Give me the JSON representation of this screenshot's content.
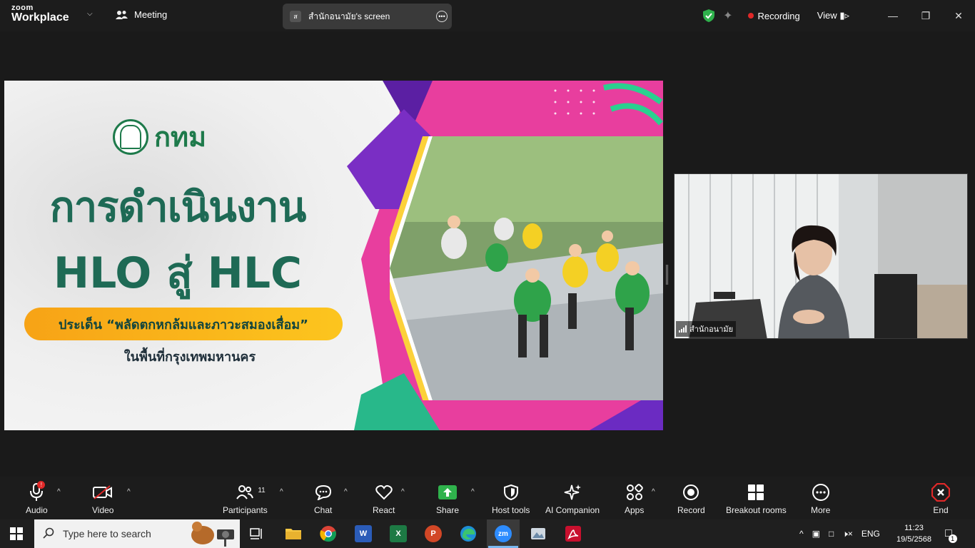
{
  "titlebar": {
    "logo_top": "zoom",
    "logo_bottom": "Workplace",
    "meeting_label": "Meeting",
    "screen_share_avatar": "ส",
    "screen_share_label": "สำนักอนามัย's screen",
    "recording_label": "Recording",
    "view_label": "View",
    "accent_green": "#2fb24c"
  },
  "slide": {
    "org_text": "กทม",
    "title_line1": "การดำเนินงาน",
    "title_line2": "HLO สู่ HLC",
    "pill_text": "ประเด็น “พลัดตกหกล้มและภาวะสมองเสื่อม”",
    "subtitle": "ในพื้นที่กรุงเทพมหานคร",
    "brand_green": "#1e6a55",
    "pill_color": "#f7a316",
    "magenta": "#e83e9e",
    "purple": "#5b1fa3"
  },
  "selfview": {
    "name": "สำนักอนามัย"
  },
  "controls": {
    "audio": "Audio",
    "audio_alert": "!",
    "video": "Video",
    "participants": "Participants",
    "participants_count": "11",
    "chat": "Chat",
    "react": "React",
    "share": "Share",
    "host_tools": "Host tools",
    "ai_companion": "AI Companion",
    "apps": "Apps",
    "record": "Record",
    "breakout": "Breakout rooms",
    "more": "More",
    "end": "End"
  },
  "taskbar": {
    "search_placeholder": "Type here to search",
    "language": "ENG",
    "time": "11:23",
    "date": "19/5/2568",
    "notification_count": "1",
    "word_letter": "W",
    "excel_letter": "X",
    "ppt_letter": "P",
    "zoom_letter": "zm"
  }
}
